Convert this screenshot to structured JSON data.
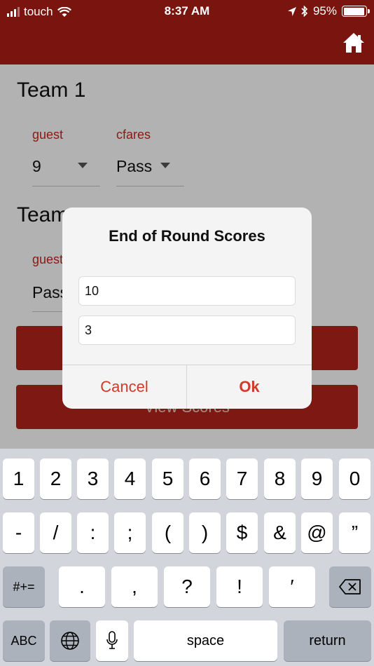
{
  "status_bar": {
    "carrier": "touch",
    "time": "8:37 AM",
    "battery": "95%",
    "battery_level": 0.95
  },
  "nav": {
    "home_icon": "home-icon"
  },
  "page": {
    "team1": {
      "title": "Team 1",
      "player1": {
        "name": "guest",
        "value": "9"
      },
      "player2": {
        "name": "cfares",
        "value": "Pass"
      }
    },
    "team2": {
      "title_visible": "Team",
      "player1": {
        "name_visible": "guest",
        "value_visible": "Pass"
      }
    },
    "view_scores_label": "View Scores"
  },
  "dialog": {
    "title": "End of Round Scores",
    "input1_value": "10",
    "input2_value": "3",
    "cancel_label": "Cancel",
    "ok_label": "Ok"
  },
  "keyboard": {
    "row1": [
      "1",
      "2",
      "3",
      "4",
      "5",
      "6",
      "7",
      "8",
      "9",
      "0"
    ],
    "row2": [
      "-",
      "/",
      ":",
      ";",
      "(",
      ")",
      "$",
      "&",
      "@",
      "”"
    ],
    "row3": {
      "mode": "#+=",
      "keys": [
        ".",
        ",",
        "?",
        "!",
        "′"
      ],
      "backspace_icon": "backspace-icon"
    },
    "row4": {
      "abc": "ABC",
      "globe_icon": "globe-icon",
      "mic_icon": "microphone-icon",
      "space": "space",
      "return": "return"
    }
  },
  "colors": {
    "brand_dark": "#7a140e",
    "brand_red": "#b3231a",
    "accent_text": "#c62820"
  }
}
